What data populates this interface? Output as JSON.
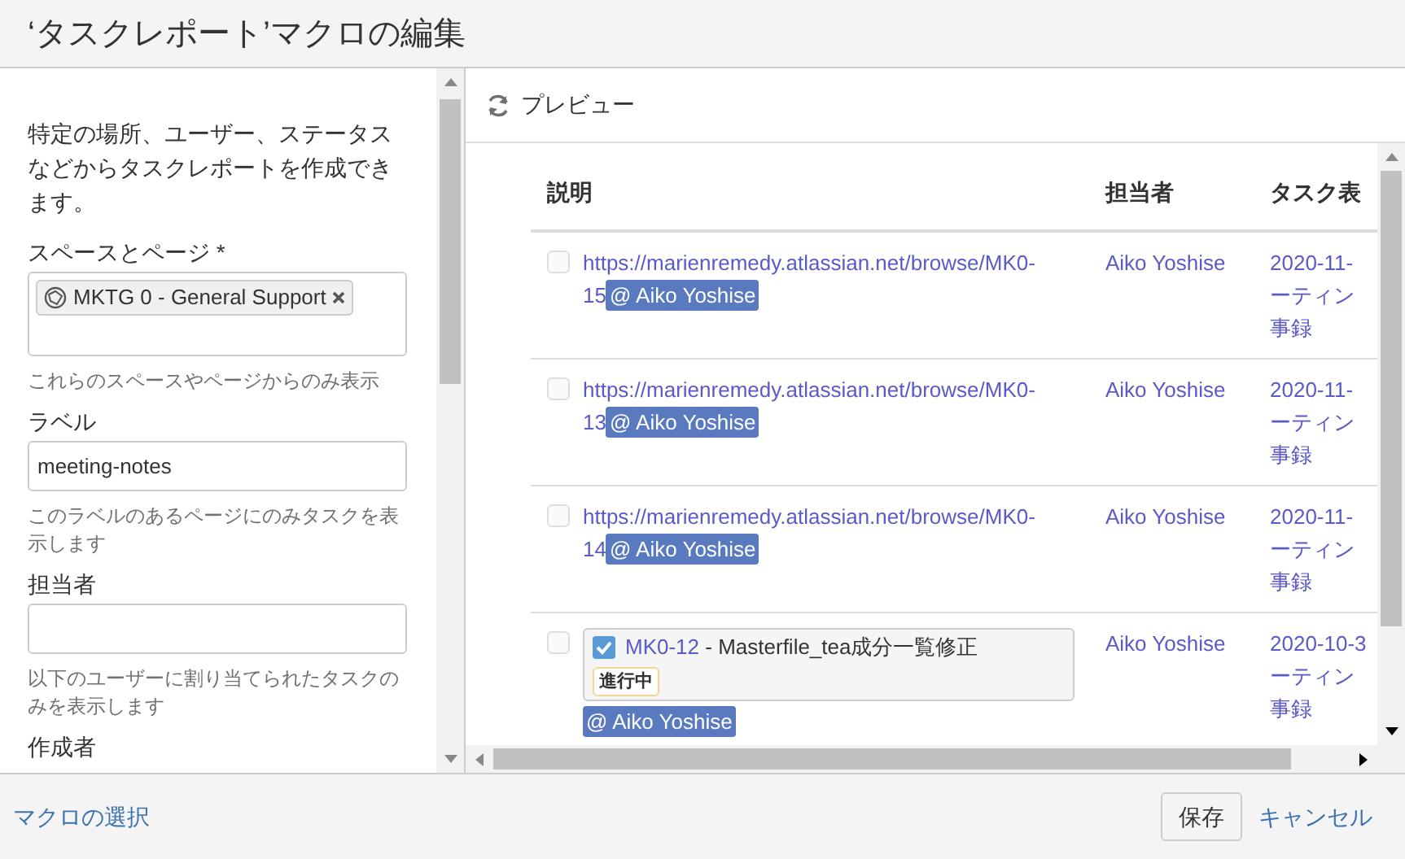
{
  "window": {
    "title": "‘タスクレポート’マクロの編集"
  },
  "form": {
    "intro": "特定の場所、ユーザー、ステータスなどからタスクレポートを作成できます。",
    "fields": [
      {
        "kind": "tags",
        "label": "スペースとページ *",
        "tags": [
          "MKTG 0 - General Support"
        ],
        "help": "これらのスペースやページからのみ表示"
      },
      {
        "kind": "text",
        "label": "ラベル",
        "value": "meeting-notes",
        "help": "このラベルのあるページにのみタスクを表示します"
      },
      {
        "kind": "text",
        "label": "担当者",
        "help": "以下のユーザーに割り当てられたタスクのみを表示します"
      },
      {
        "kind": "label",
        "label": "作成者"
      }
    ]
  },
  "preview": {
    "title": "プレビュー",
    "table": {
      "columns": [
        "説明",
        "担当者",
        "タスク表"
      ],
      "rows": [
        {
          "kind": "link",
          "checked": false,
          "link": "https://marienremedy.atlassian.net/browse/MK0-",
          "link_end": "15",
          "mention": "@ Aiko Yoshise",
          "assignee": "Aiko Yoshise",
          "task": [
            "2020-11-",
            "ーティン",
            "事録"
          ]
        },
        {
          "kind": "link",
          "checked": false,
          "link": "https://marienremedy.atlassian.net/browse/MK0-",
          "link_end": "13",
          "mention": "@ Aiko Yoshise",
          "assignee": "Aiko Yoshise",
          "task": [
            "2020-11-",
            "ーティン",
            "事録"
          ]
        },
        {
          "kind": "link",
          "checked": false,
          "link": "https://marienremedy.atlassian.net/browse/MK0-",
          "link_end": "14",
          "mention": "@ Aiko Yoshise",
          "assignee": "Aiko Yoshise",
          "task": [
            "2020-11-",
            "ーティン",
            "事録"
          ]
        },
        {
          "kind": "issue",
          "checked": false,
          "issue_checked": true,
          "issue_key": "MK0-12",
          "issue_title": " - Masterfile_tea成分一覧修正",
          "status": "進行中",
          "mention": "@ Aiko Yoshise",
          "assignee": "Aiko Yoshise",
          "task": [
            "2020-10-3",
            "ーティン",
            "事録"
          ]
        }
      ]
    }
  },
  "footer": {
    "back": "マクロの選択",
    "save": "保存",
    "cancel": "キャンセル"
  }
}
